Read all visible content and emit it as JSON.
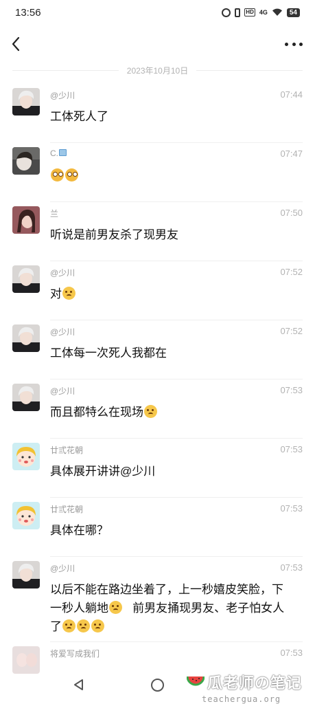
{
  "status_bar": {
    "time": "13:56",
    "battery": "54",
    "network": "4G",
    "hd": "HD"
  },
  "nav": {
    "back_icon": "chevron-left-icon",
    "more_icon": "more-dots-icon"
  },
  "date_separator": "2023年10月10日",
  "messages": [
    {
      "name": "@少川",
      "time": "07:44",
      "text": "工体死人了",
      "avatar": "avatar-shaochuan"
    },
    {
      "name": "C.",
      "time": "07:47",
      "text": "",
      "avatar": "avatar-c",
      "emojis": [
        "flushed-emoji",
        "flushed-emoji"
      ]
    },
    {
      "name": "兰",
      "time": "07:50",
      "text": "听说是前男友杀了现男友",
      "avatar": "avatar-lan"
    },
    {
      "name": "@少川",
      "time": "07:52",
      "text": "对",
      "avatar": "avatar-shaochuan",
      "emojis": [
        "grimace-emoji"
      ]
    },
    {
      "name": "@少川",
      "time": "07:52",
      "text": "工体每一次死人我都在",
      "avatar": "avatar-shaochuan"
    },
    {
      "name": "@少川",
      "time": "07:53",
      "text": "而且都特么在现场",
      "avatar": "avatar-shaochuan",
      "emojis": [
        "grimace-emoji"
      ]
    },
    {
      "name": "廿弎花朝",
      "time": "07:53",
      "text": "具体展开讲讲@少川",
      "avatar": "avatar-ershan"
    },
    {
      "name": "廿弎花朝",
      "time": "07:53",
      "text": "具体在哪？",
      "avatar": "avatar-ershan"
    },
    {
      "name": "@少川",
      "time": "07:53",
      "text_parts": [
        "以后不能在路边坐着了，上一秒嬉皮笑脸，下一秒人躺地",
        "   前男友捅现男友、老子怕女人了"
      ],
      "avatar": "avatar-shaochuan",
      "emojis": [
        "grimace-emoji",
        "grimace-emoji",
        "grimace-emoji",
        "grimace-emoji"
      ]
    },
    {
      "name": "将爱写成我们",
      "time": "07:53",
      "text": "",
      "avatar": "avatar-jiangai"
    }
  ],
  "bottom_bar": {
    "watermark_title": "瓜老师の笔记",
    "watermark_url": "teachergua.org"
  }
}
